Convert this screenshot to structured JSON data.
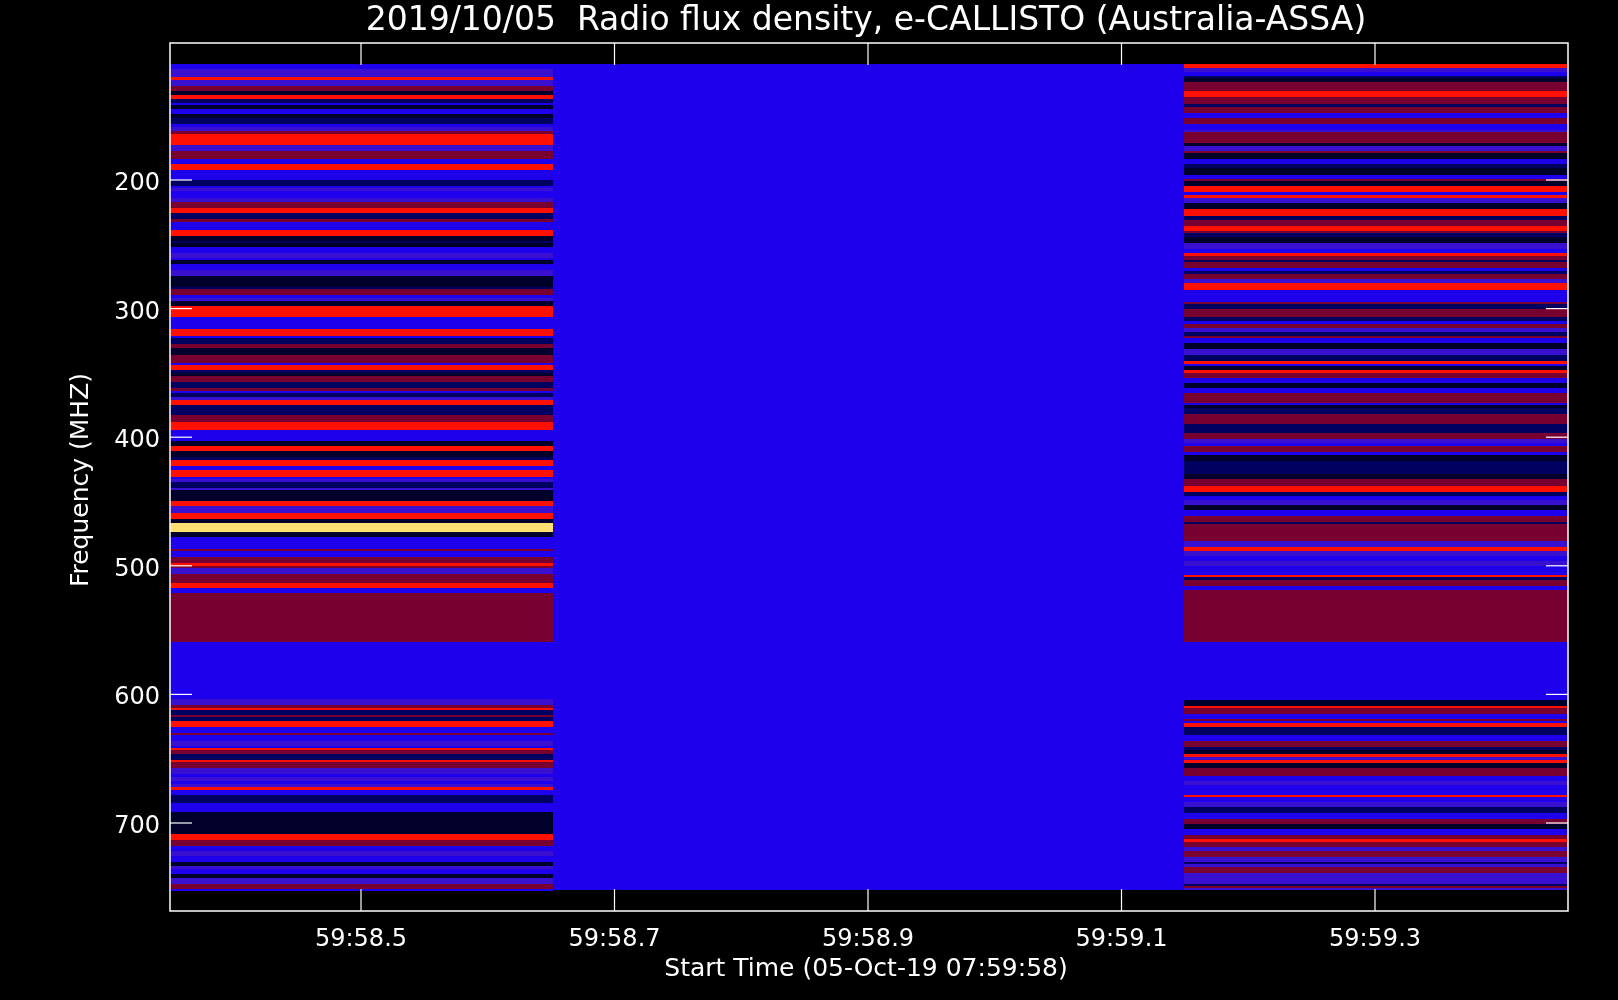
{
  "title": "2019/10/05  Radio flux density, e-CALLISTO (Australia-ASSA)",
  "y_axis": {
    "label": "Frequency (MHZ)",
    "ticks": [
      "200",
      "300",
      "400",
      "500",
      "600",
      "700"
    ]
  },
  "x_axis": {
    "label": "Start Time (05-Oct-19 07:59:58)",
    "ticks": [
      "59:58.5",
      "59:58.7",
      "59:58.9",
      "59:59.1",
      "59:59.3"
    ]
  }
}
